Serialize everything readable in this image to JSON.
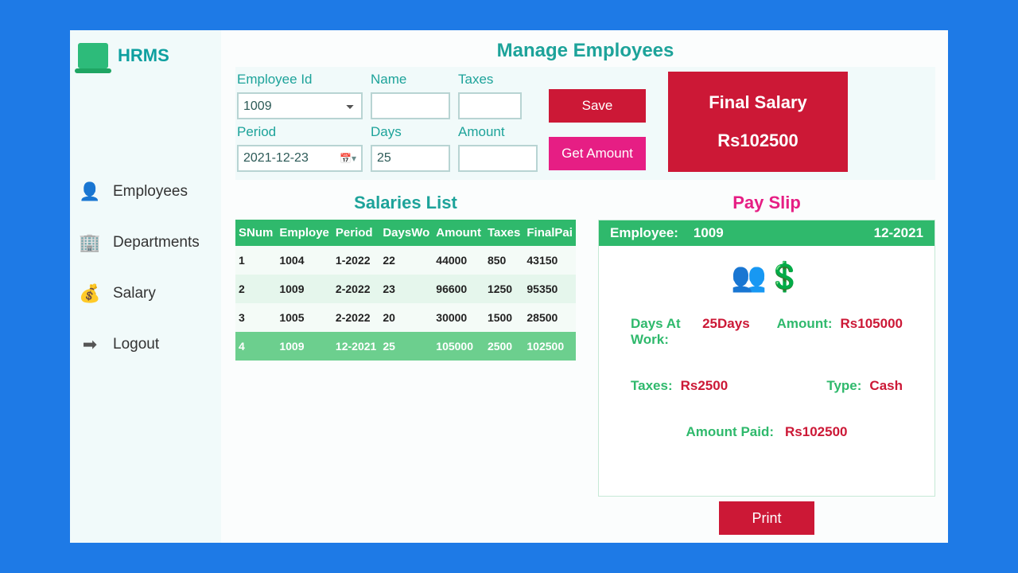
{
  "app_name": "HRMS",
  "nav": {
    "employees": "Employees",
    "departments": "Departments",
    "salary": "Salary",
    "logout": "Logout"
  },
  "page_title": "Manage Employees",
  "form": {
    "employee_id_label": "Employee Id",
    "employee_id_value": "1009",
    "name_label": "Name",
    "name_value": "",
    "taxes_label": "Taxes",
    "taxes_value": "",
    "period_label": "Period",
    "period_value": "2021-12-23",
    "days_label": "Days",
    "days_value": "25",
    "amount_label": "Amount",
    "amount_value": "",
    "save": "Save",
    "get_amount": "Get Amount"
  },
  "final": {
    "title": "Final Salary",
    "value": "Rs102500"
  },
  "salaries": {
    "title": "Salaries List",
    "headers": [
      "SNum",
      "Employe",
      "Period",
      "DaysWo",
      "Amount",
      "Taxes",
      "FinalPai"
    ],
    "rows": [
      {
        "snum": "1",
        "emp": "1004",
        "period": "1-2022",
        "days": "22",
        "amount": "44000",
        "taxes": "850",
        "final": "43150",
        "selected": false
      },
      {
        "snum": "2",
        "emp": "1009",
        "period": "2-2022",
        "days": "23",
        "amount": "96600",
        "taxes": "1250",
        "final": "95350",
        "selected": false
      },
      {
        "snum": "3",
        "emp": "1005",
        "period": "2-2022",
        "days": "20",
        "amount": "30000",
        "taxes": "1500",
        "final": "28500",
        "selected": false
      },
      {
        "snum": "4",
        "emp": "1009",
        "period": "12-2021",
        "days": "25",
        "amount": "105000",
        "taxes": "2500",
        "final": "102500",
        "selected": true
      }
    ]
  },
  "slip": {
    "title": "Pay Slip",
    "employee_label": "Employee:",
    "employee_value": "1009",
    "period": "12-2021",
    "days_label": "Days At Work:",
    "days_value": "25Days",
    "amount_label": "Amount:",
    "amount_value": "Rs105000",
    "taxes_label": "Taxes:",
    "taxes_value": "Rs2500",
    "type_label": "Type:",
    "type_value": "Cash",
    "paid_label": "Amount Paid:",
    "paid_value": "Rs102500",
    "print": "Print"
  }
}
